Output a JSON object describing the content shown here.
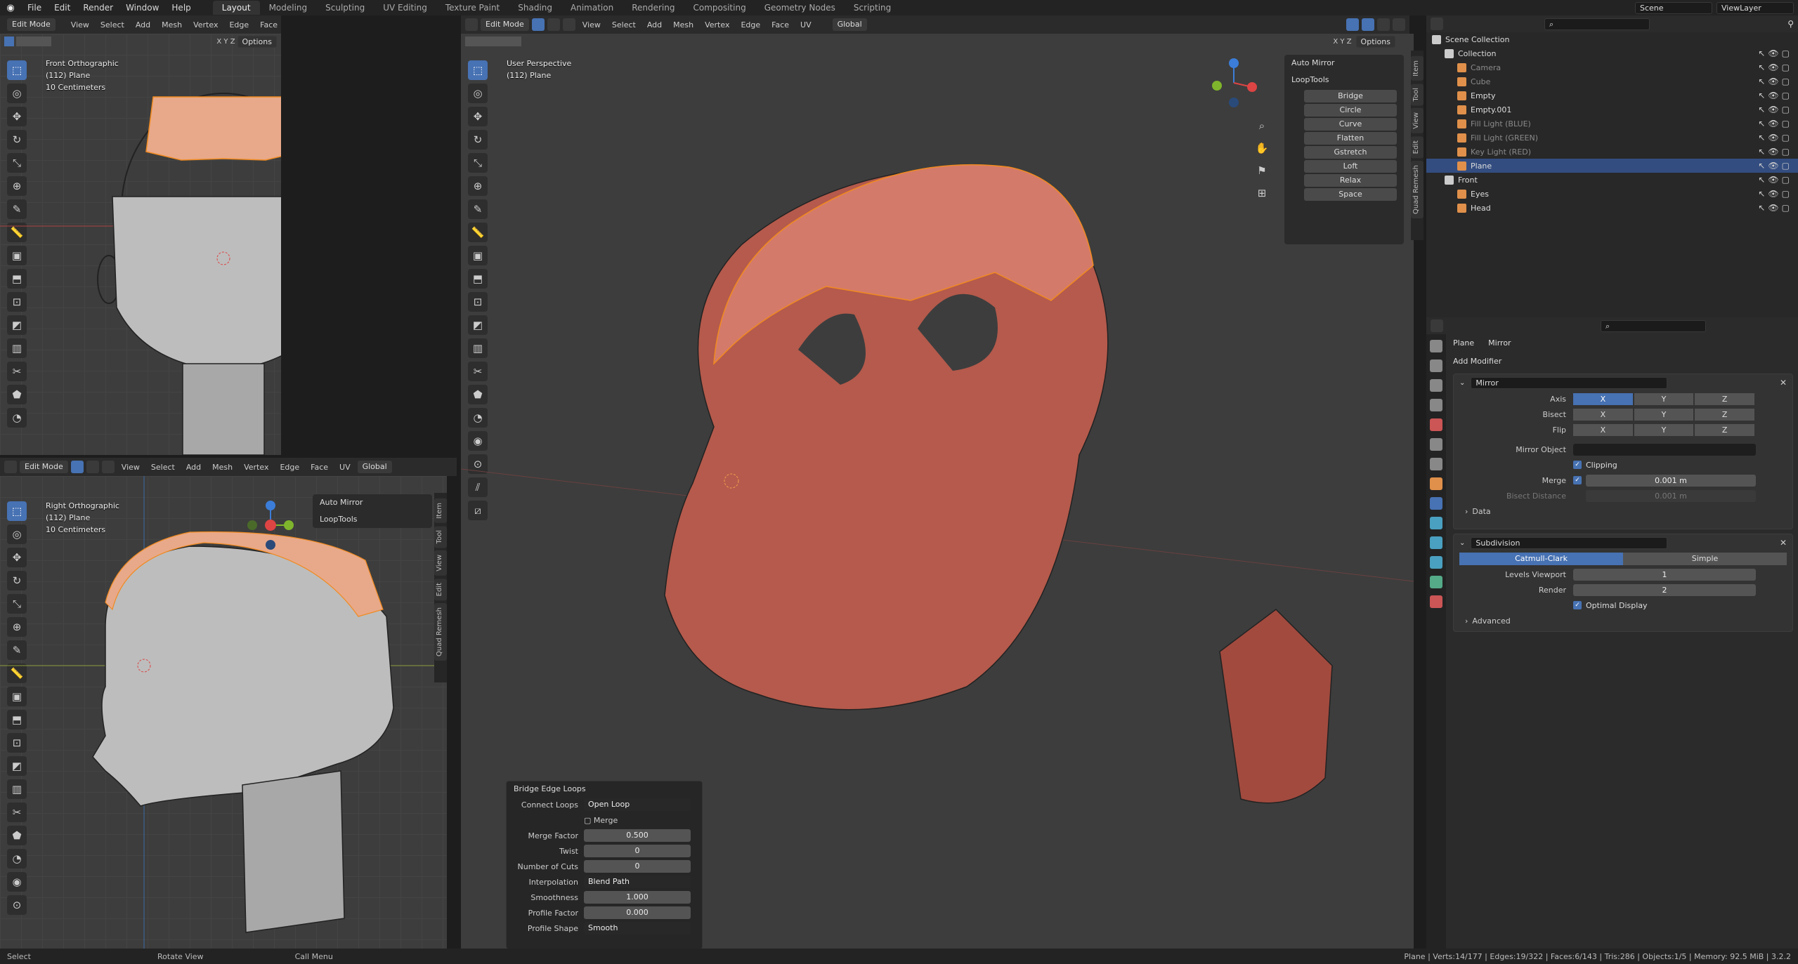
{
  "topbar": {
    "menus": [
      "File",
      "Edit",
      "Render",
      "Window",
      "Help"
    ],
    "workspaces": [
      "Layout",
      "Modeling",
      "Sculpting",
      "UV Editing",
      "Texture Paint",
      "Shading",
      "Animation",
      "Rendering",
      "Compositing",
      "Geometry Nodes",
      "Scripting"
    ],
    "active_workspace": "Layout",
    "scene": "Scene",
    "view_layer": "ViewLayer"
  },
  "viewport_header": {
    "mode": "Edit Mode",
    "menus": [
      "View",
      "Select",
      "Add",
      "Mesh",
      "Vertex",
      "Edge",
      "Face",
      "UV"
    ],
    "orientation": "Global",
    "options": "Options",
    "axes": [
      "X",
      "Y",
      "Z"
    ]
  },
  "left_menus": [
    "View",
    "Select",
    "Add",
    "Mesh",
    "Vertex",
    "Edge",
    "Face",
    "UV"
  ],
  "front_view": {
    "line1": "Front Orthographic",
    "line2": "(112) Plane",
    "line3": "10 Centimeters"
  },
  "right_view": {
    "line1": "Right Orthographic",
    "line2": "(112) Plane",
    "line3": "10 Centimeters"
  },
  "persp_view": {
    "line1": "User Perspective",
    "line2": "(112) Plane"
  },
  "npanel": {
    "auto_mirror": "Auto Mirror",
    "looptools": "LoopTools",
    "buttons": [
      "Bridge",
      "Circle",
      "Curve",
      "Flatten",
      "Gstretch",
      "Loft",
      "Relax",
      "Space"
    ]
  },
  "side_tabs": [
    "Item",
    "Tool",
    "View",
    "Edit",
    "Quad Remesh"
  ],
  "operator": {
    "title": "Bridge Edge Loops",
    "connect_loops_label": "Connect Loops",
    "connect_loops": "Open Loop",
    "merge": "Merge",
    "merge_factor_label": "Merge Factor",
    "merge_factor": "0.500",
    "twist_label": "Twist",
    "twist": "0",
    "cuts_label": "Number of Cuts",
    "cuts": "0",
    "interp_label": "Interpolation",
    "interp": "Blend Path",
    "smooth_label": "Smoothness",
    "smooth": "1.000",
    "pfactor_label": "Profile Factor",
    "pfactor": "0.000",
    "pshape_label": "Profile Shape",
    "pshape": "Smooth"
  },
  "outliner": {
    "title": "Scene Collection",
    "rows": [
      {
        "name": "Collection",
        "indent": 1,
        "color": "#ccc",
        "dim": false,
        "sel": false
      },
      {
        "name": "Camera",
        "indent": 2,
        "color": "#e0904a",
        "dim": true,
        "sel": false
      },
      {
        "name": "Cube",
        "indent": 2,
        "color": "#e0904a",
        "dim": true,
        "sel": false
      },
      {
        "name": "Empty",
        "indent": 2,
        "color": "#e0904a",
        "dim": false,
        "sel": false
      },
      {
        "name": "Empty.001",
        "indent": 2,
        "color": "#e0904a",
        "dim": false,
        "sel": false
      },
      {
        "name": "Fill Light (BLUE)",
        "indent": 2,
        "color": "#e0904a",
        "dim": true,
        "sel": false
      },
      {
        "name": "Fill Light (GREEN)",
        "indent": 2,
        "color": "#e0904a",
        "dim": true,
        "sel": false
      },
      {
        "name": "Key Light (RED)",
        "indent": 2,
        "color": "#e0904a",
        "dim": true,
        "sel": false
      },
      {
        "name": "Plane",
        "indent": 2,
        "color": "#e0904a",
        "dim": false,
        "sel": true
      },
      {
        "name": "Front",
        "indent": 1,
        "color": "#ccc",
        "dim": false,
        "sel": false
      },
      {
        "name": "Eyes",
        "indent": 2,
        "color": "#e0904a",
        "dim": false,
        "sel": false
      },
      {
        "name": "Head",
        "indent": 2,
        "color": "#e0904a",
        "dim": false,
        "sel": false
      }
    ]
  },
  "properties": {
    "object": "Plane",
    "modifier_crumb": "Mirror",
    "add_modifier": "Add Modifier",
    "mirror": {
      "name": "Mirror",
      "axis_label": "Axis",
      "bisect_label": "Bisect",
      "flip_label": "Flip",
      "axes": [
        "X",
        "Y",
        "Z"
      ],
      "mirror_object_label": "Mirror Object",
      "clipping": "Clipping",
      "merge_label": "Merge",
      "merge_value": "0.001 m",
      "bisect_distance_label": "Bisect Distance",
      "bisect_distance": "0.001 m",
      "data": "Data"
    },
    "subdivision": {
      "name": "Subdivision",
      "catmull": "Catmull-Clark",
      "simple": "Simple",
      "levels_label": "Levels Viewport",
      "levels": "1",
      "render_label": "Render",
      "render": "2",
      "optimal": "Optimal Display",
      "advanced": "Advanced"
    }
  },
  "status": {
    "select": "Select",
    "rotate": "Rotate View",
    "menu": "Call Menu",
    "stats": "Plane | Verts:14/177 | Edges:19/322 | Faces:6/143 | Tris:286 | Objects:1/5 | Memory: 92.5 MiB | 3.2.2"
  }
}
